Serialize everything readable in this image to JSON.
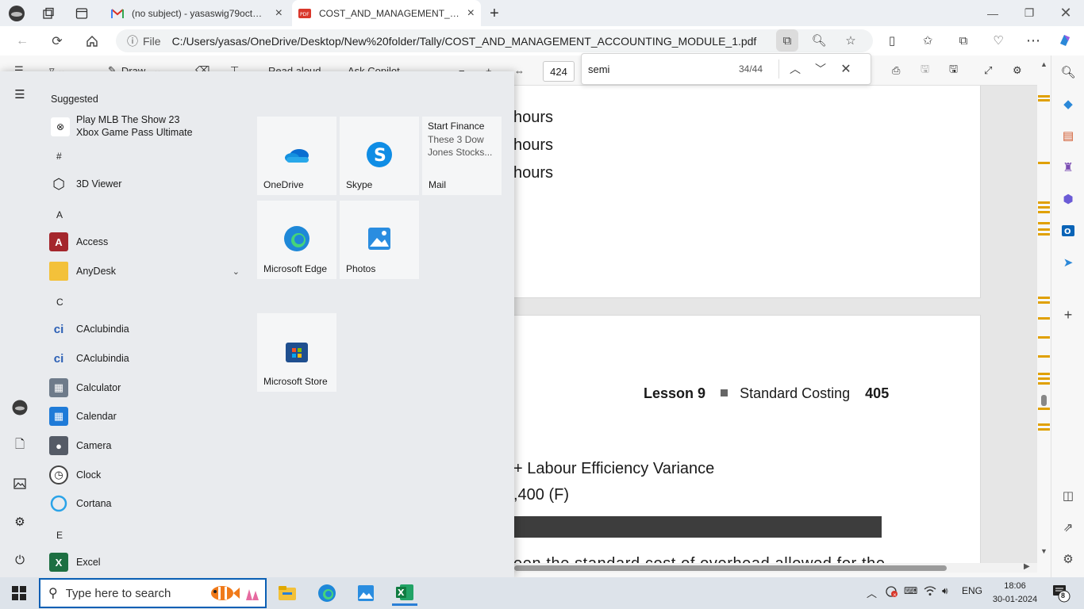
{
  "browser": {
    "tabs": [
      {
        "title": "(no subject) - yasaswig79oct@gm",
        "icon": "gmail-icon",
        "active": false
      },
      {
        "title": "COST_AND_MANAGEMENT_ACCOUNTING_MODULE_1.pdf",
        "icon": "pdf-icon",
        "active": true
      }
    ],
    "address": {
      "scheme_label": "File",
      "url": "C:/Users/yasas/OneDrive/Desktop/New%20folder/Tally/COST_AND_MANAGEMENT_ACCOUNTING_MODULE_1.pdf"
    }
  },
  "pdf_toolbar": {
    "draw_label": "Draw",
    "read_aloud_label": "Read aloud",
    "ask_copilot_label": "Ask Copilot",
    "page_number": "424"
  },
  "find": {
    "query": "semi",
    "count": "34/44"
  },
  "pdf_content": {
    "page1_lines": [
      "hours",
      "hours",
      "hours"
    ],
    "page2": {
      "lesson": "Lesson 9",
      "section": "Standard Costing",
      "page_no": "405",
      "line1": "+ Labour Efficiency Variance",
      "line2": ",400 (F)",
      "line3": "een the standard cost of overhead allowed for the"
    }
  },
  "start_menu": {
    "suggested_heading": "Suggested",
    "suggested_app": {
      "title": "Play MLB The Show 23",
      "subtitle": "Xbox Game Pass Ultimate"
    },
    "letters": {
      "hash": "#",
      "a": "A",
      "c": "C",
      "e": "E"
    },
    "apps": {
      "viewer3d": "3D Viewer",
      "access": "Access",
      "anydesk": "AnyDesk",
      "caclub1": "CAclubindia",
      "caclub2": "CAclubindia",
      "calculator": "Calculator",
      "calendar": "Calendar",
      "camera": "Camera",
      "clock": "Clock",
      "cortana": "Cortana",
      "excel": "Excel"
    },
    "tiles": {
      "onedrive": "OneDrive",
      "skype": "Skype",
      "mail": "Mail",
      "mail_headline": "Start Finance",
      "mail_news": "These 3 Dow Jones Stocks...",
      "edge": "Microsoft Edge",
      "photos": "Photos",
      "store": "Microsoft Store"
    }
  },
  "taskbar": {
    "search_placeholder": "Type here to search",
    "language": "ENG",
    "time": "18:06",
    "date": "30-01-2024",
    "notification_count": "8"
  },
  "colors": {
    "accent": "#0a5fb4",
    "find_mark": "#e0a000",
    "pdf_red": "#d9372b"
  }
}
